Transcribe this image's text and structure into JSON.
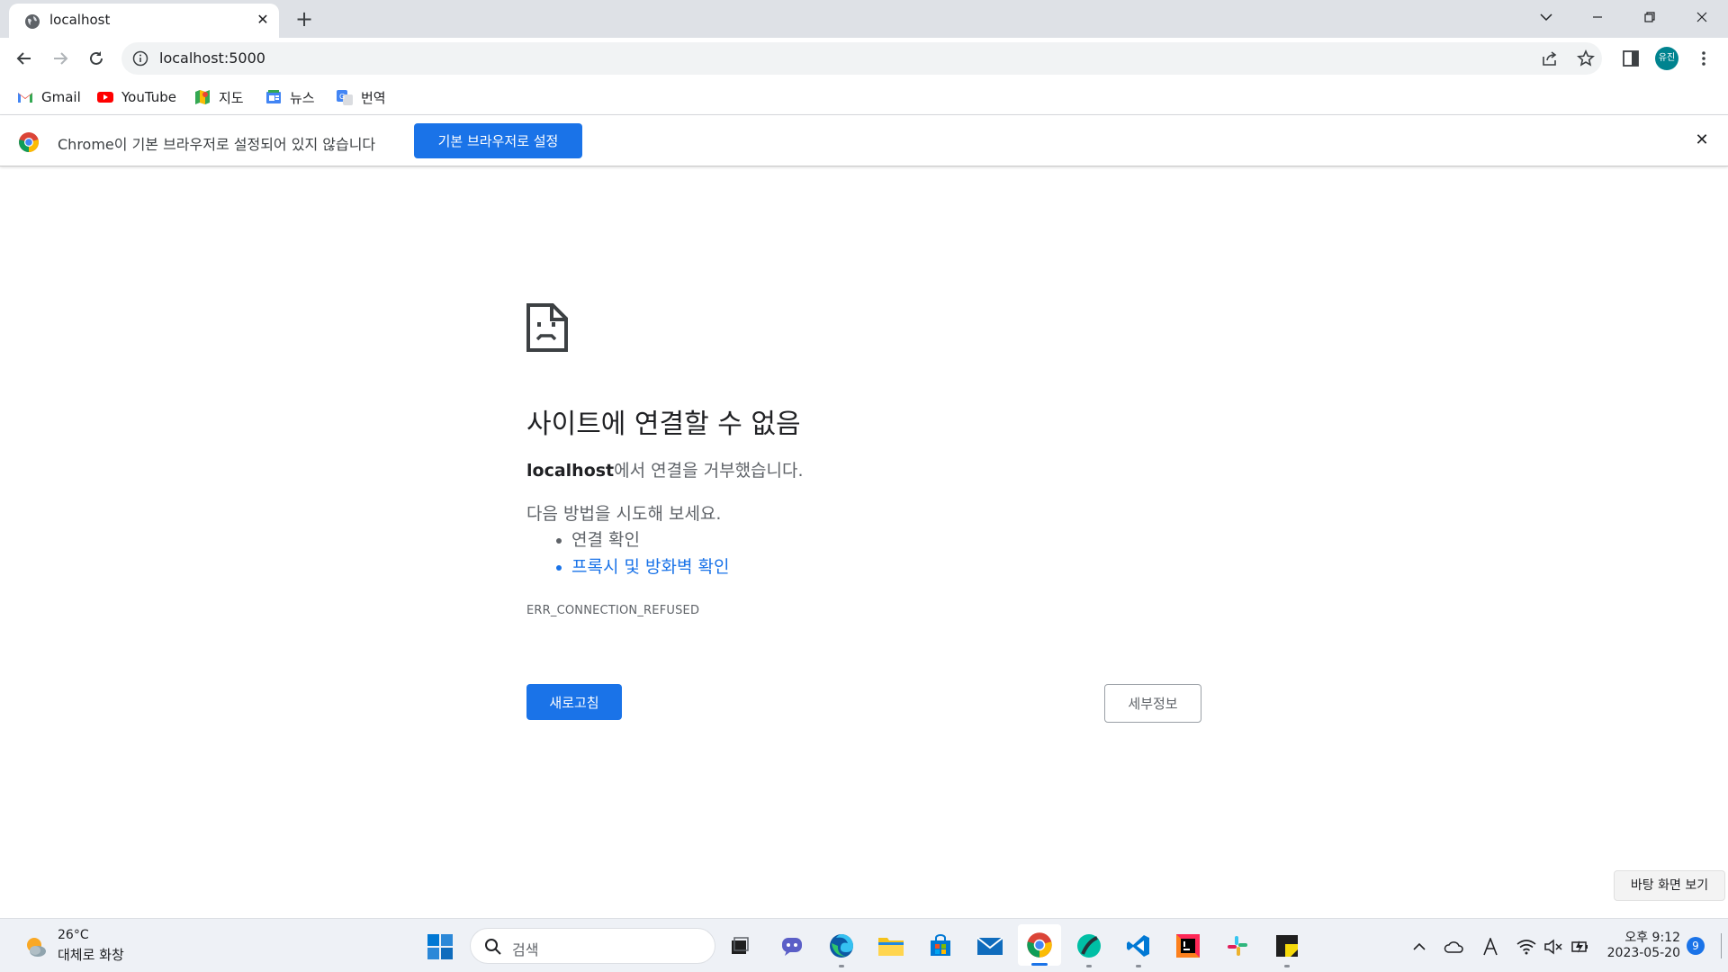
{
  "browser": {
    "tab": {
      "title": "localhost",
      "close_glyph": "✕"
    },
    "new_tab_glyph": "+",
    "address": "localhost:5000",
    "profile_initials": "유진",
    "profile_color": "#00838f"
  },
  "bookmarks": [
    {
      "label": "Gmail",
      "icon": "gmail-icon"
    },
    {
      "label": "YouTube",
      "icon": "youtube-icon"
    },
    {
      "label": "지도",
      "icon": "maps-icon"
    },
    {
      "label": "뉴스",
      "icon": "news-icon"
    },
    {
      "label": "번역",
      "icon": "translate-icon"
    }
  ],
  "infobar": {
    "message": "Chrome이 기본 브라우저로 설정되어 있지 않습니다",
    "button": "기본 브라우저로 설정",
    "close_glyph": "✕"
  },
  "error": {
    "title": "사이트에 연결할 수 없음",
    "host": "localhost",
    "desc_suffix": "에서 연결을 거부했습니다.",
    "try_heading": "다음 방법을 시도해 보세요.",
    "suggestions": [
      {
        "text": "연결 확인",
        "link": false
      },
      {
        "text": "프록시 및 방화벽 확인",
        "link": true
      }
    ],
    "code": "ERR_CONNECTION_REFUSED",
    "reload_button": "새로고침",
    "details_button": "세부정보"
  },
  "desktop_tooltip": "바탕 화면 보기",
  "taskbar": {
    "weather": {
      "temp": "26°C",
      "desc": "대체로 화창"
    },
    "search_label": "검색",
    "clock_time": "오후 9:12",
    "clock_date": "2023-05-20",
    "notification_count": "9"
  },
  "colors": {
    "accent": "#1a73e8",
    "tab_strip": "#dee1e6",
    "omnibox": "#f1f3f4",
    "taskbar": "#eef1f6"
  }
}
